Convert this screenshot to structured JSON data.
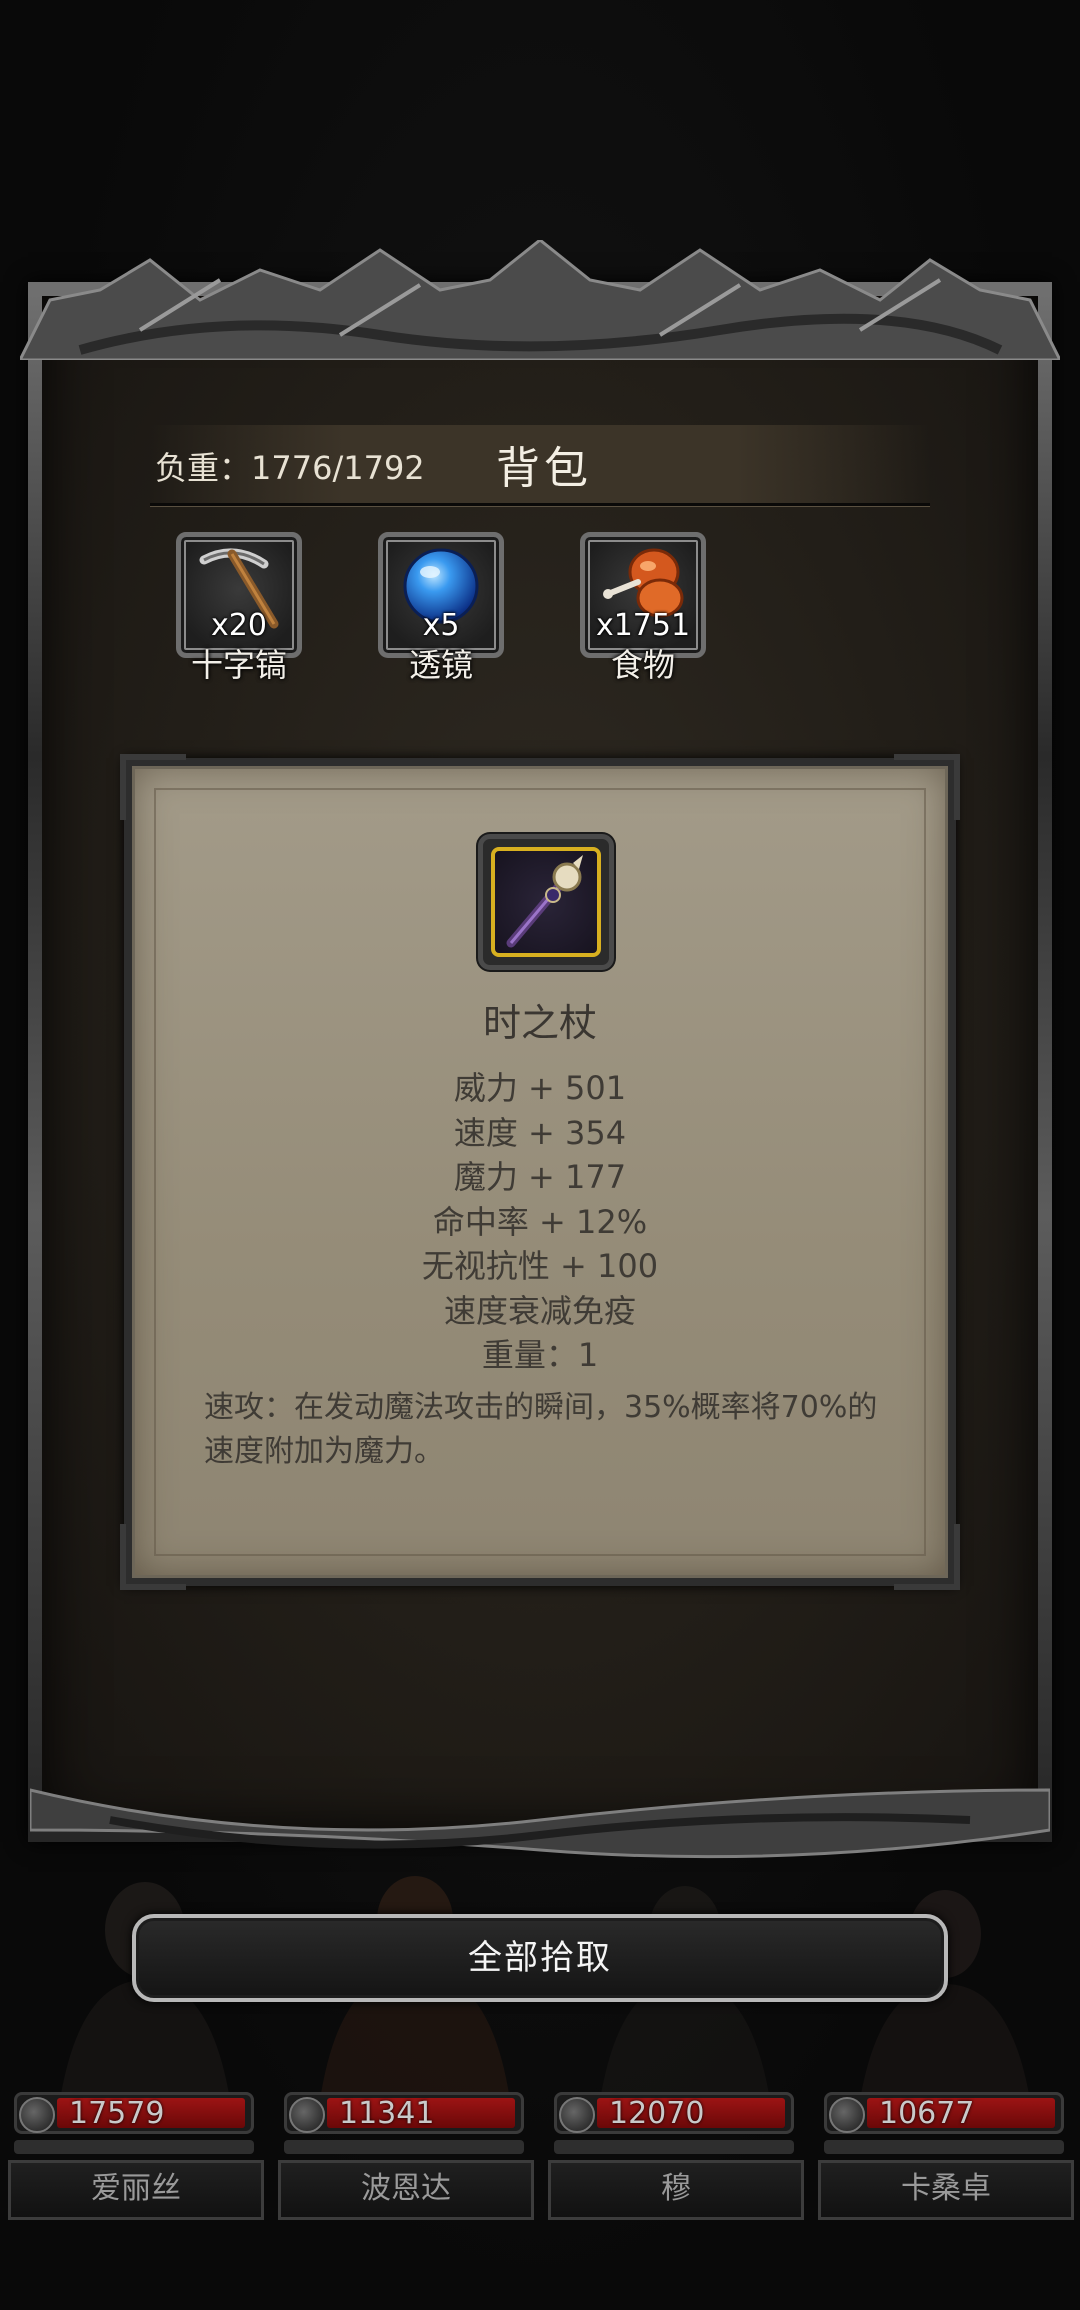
{
  "backpack": {
    "weight_text": "负重：1776/1792",
    "title": "背包"
  },
  "inventory": [
    {
      "name": "十字镐",
      "count": "x20",
      "icon": "pickaxe-icon"
    },
    {
      "name": "透镜",
      "count": "x5",
      "icon": "lens-orb-icon"
    },
    {
      "name": "食物",
      "count": "x1751",
      "icon": "meat-drumstick-icon"
    }
  ],
  "tooltip": {
    "item_name": "时之杖",
    "item_icon": "staff-icon",
    "stats": [
      "威力 + 501",
      "速度 + 354",
      "魔力 + 177",
      "命中率 + 12%",
      "无视抗性 + 100",
      "速度衰减免疫",
      "重量：1"
    ],
    "description": "速攻：在发动魔法攻击的瞬间，35%概率将70%的速度附加为魔力。"
  },
  "actions": {
    "pickup_all": "全部拾取"
  },
  "party": [
    {
      "name": "爱丽丝",
      "hp": "17579"
    },
    {
      "name": "波恩达",
      "hp": "11341"
    },
    {
      "name": "穆",
      "hp": "12070"
    },
    {
      "name": "卡桑卓",
      "hp": "10677"
    }
  ],
  "colors": {
    "hp_red": "#9c1414",
    "card_parchment": "#a39b89",
    "slot_frame": "#6e6e6e",
    "item_rarity_gold": "#d8b020"
  }
}
